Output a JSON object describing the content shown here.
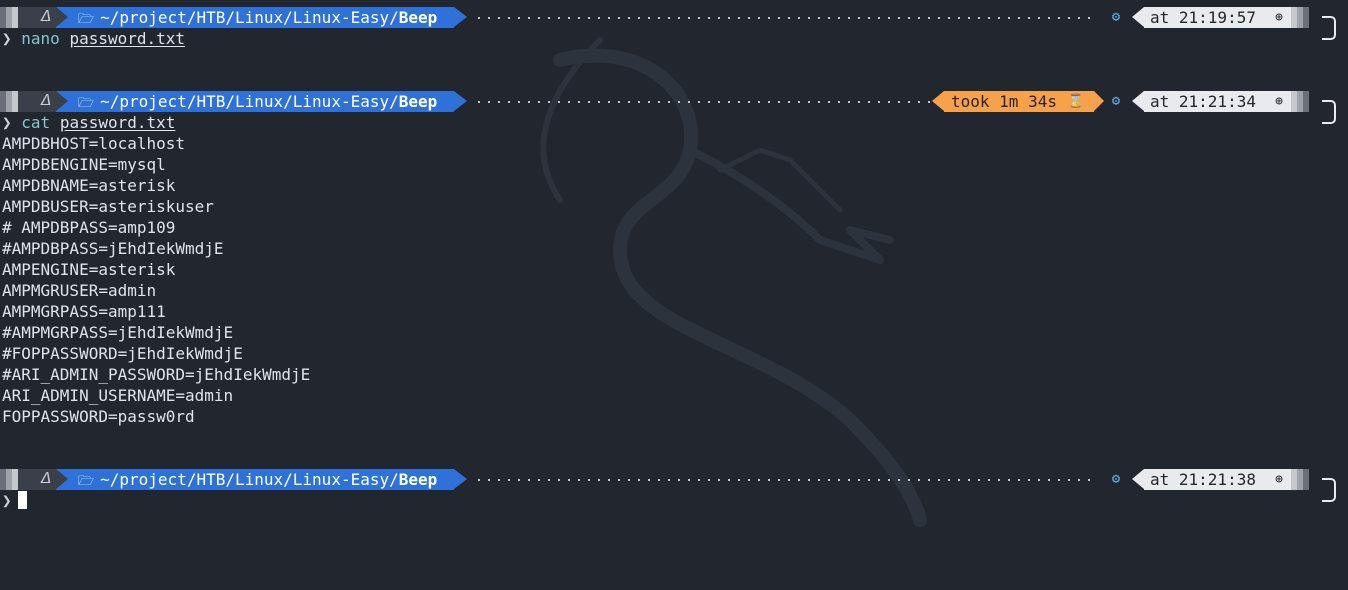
{
  "prompts": [
    {
      "os_icon": "kali-icon",
      "dir_prefix": "~/project/HTB/Linux/Linux-Easy/",
      "dir_last": "Beep",
      "time": "at 21:19:57",
      "caret": "❯",
      "command": "nano",
      "argument": "password.txt"
    },
    {
      "os_icon": "kali-icon",
      "dir_prefix": "~/project/HTB/Linux/Linux-Easy/",
      "dir_last": "Beep",
      "duration": "took 1m 34s",
      "time": "at 21:21:34",
      "caret": "❯",
      "command": "cat",
      "argument": "password.txt"
    },
    {
      "os_icon": "kali-icon",
      "dir_prefix": "~/project/HTB/Linux/Linux-Easy/",
      "dir_last": "Beep",
      "time": "at 21:21:38",
      "caret": "❯"
    }
  ],
  "output_lines": [
    "AMPDBHOST=localhost",
    "AMPDBENGINE=mysql",
    "AMPDBNAME=asterisk",
    "AMPDBUSER=asteriskuser",
    "# AMPDBPASS=amp109",
    "#AMPDBPASS=jEhdIekWmdjE",
    "AMPENGINE=asterisk",
    "AMPMGRUSER=admin",
    "AMPMGRPASS=amp111",
    "#AMPMGRPASS=jEhdIekWmdjE",
    "#FOPPASSWORD=jEhdIekWmdjE",
    "#ARI_ADMIN_PASSWORD=jEhdIekWmdjE",
    "ARI_ADMIN_USERNAME=admin",
    "FOPPASSWORD=passw0rd"
  ],
  "colors": {
    "background": "#21262f",
    "dir_segment": "#2e72d9",
    "duration_segment": "#f7a24a",
    "time_segment": "#e8eaee",
    "command": "#86c5c9",
    "gear": "#5fb6e6"
  }
}
